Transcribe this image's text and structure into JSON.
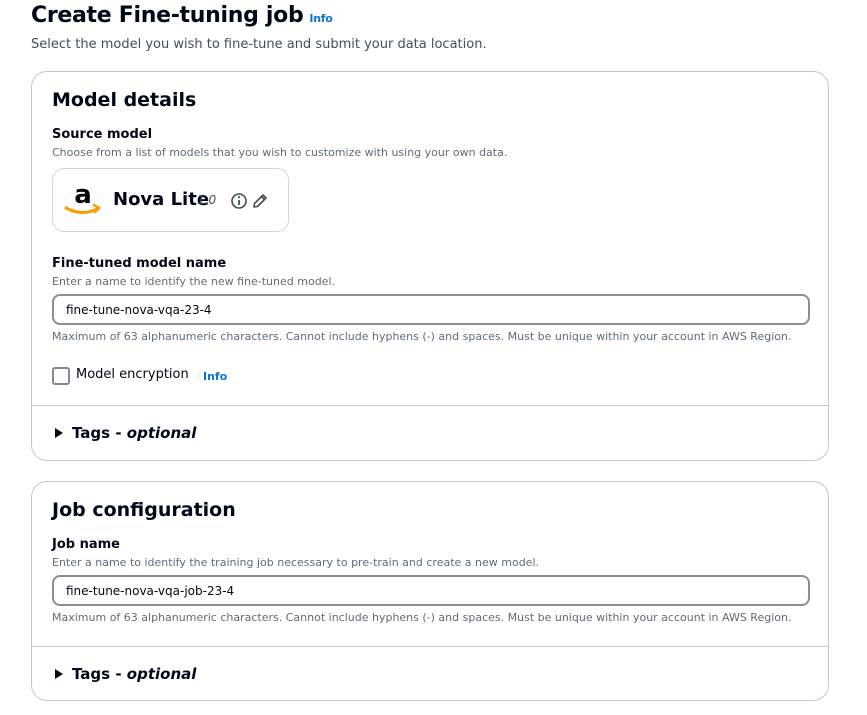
{
  "header": {
    "title": "Create Fine-tuning job",
    "info": "Info",
    "subtitle": "Select the model you wish to fine-tune and submit your data location."
  },
  "model_details": {
    "title": "Model details",
    "source_model": {
      "label": "Source model",
      "description": "Choose from a list of models that you wish to customize with using your own data.",
      "model_name": "Nova Lite",
      "model_version": "1.0",
      "logo_text": "a"
    },
    "fine_tuned_name": {
      "label": "Fine-tuned model name",
      "description": "Enter a name to identify the new fine-tuned model.",
      "value": "fine-tune-nova-vqa-23-4",
      "constraint": "Maximum of 63 alphanumeric characters. Cannot include hyphens (-) and spaces. Must be unique within your account in AWS Region."
    },
    "encryption": {
      "label": "Model encryption",
      "info": "Info",
      "checked": false
    },
    "tags": {
      "label": "Tags",
      "separator": "-",
      "optional": "optional"
    }
  },
  "job_configuration": {
    "title": "Job configuration",
    "job_name": {
      "label": "Job name",
      "description": "Enter a name to identify the training job necessary to pre-train and create a new model.",
      "value": "fine-tune-nova-vqa-job-23-4",
      "constraint": "Maximum of 63 alphanumeric characters. Cannot include hyphens (-) and spaces. Must be unique within your account in AWS Region."
    },
    "tags": {
      "label": "Tags",
      "separator": "-",
      "optional": "optional"
    }
  },
  "colors": {
    "link": "#0972d3",
    "text": "#000716",
    "border": "#c6c6cd",
    "amazon_orange": "#ff9900"
  },
  "icons": {
    "info": "info-circle-icon",
    "edit": "pencil-icon",
    "expand": "caret-right-icon"
  }
}
